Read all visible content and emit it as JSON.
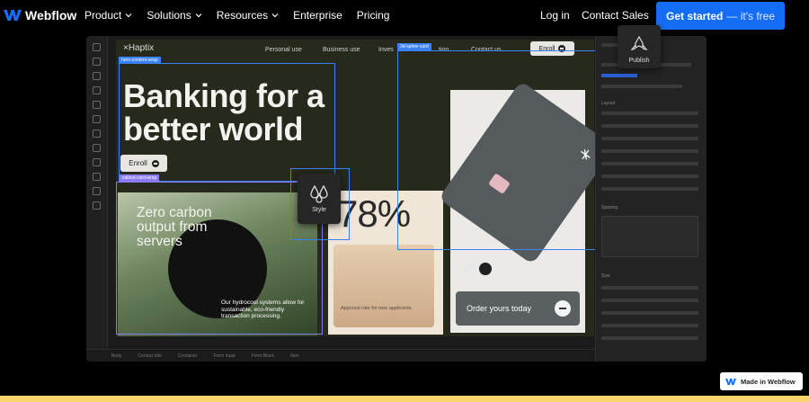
{
  "brand": {
    "name": "Webflow"
  },
  "nav": {
    "items": [
      {
        "label": "Product",
        "dropdown": true
      },
      {
        "label": "Solutions",
        "dropdown": true
      },
      {
        "label": "Resources",
        "dropdown": true
      },
      {
        "label": "Enterprise",
        "dropdown": false
      },
      {
        "label": "Pricing",
        "dropdown": false
      }
    ],
    "login": "Log in",
    "contact": "Contact Sales",
    "cta": {
      "label": "Get started",
      "sub": "— it's free"
    }
  },
  "colors": {
    "accent": "#146ef5",
    "page_bg": "#000000",
    "bottom_strip": "#f7d36b"
  },
  "designer": {
    "site": {
      "logo": "×Haptix",
      "nav": [
        "Personal use",
        "Business use",
        "Inves",
        "tion",
        "Contact us"
      ],
      "enroll_top": "Enroll",
      "hero_title": "Banking for a better world",
      "hero_enroll": "Enroll",
      "green_card": {
        "heading": "Zero carbon output from servers",
        "body": "Our hydrocool systems allow for sustainable, eco-friendly transaction processing."
      },
      "beige_card": {
        "stat": "78%",
        "caption": "Approval rate for new applicants"
      },
      "order_button": "Order yours today"
    },
    "tags": {
      "hero": "hero-content-wrap",
      "callout": "callout-card-wrap",
      "spline": "3d-spline-card"
    },
    "popovers": {
      "style": "Style",
      "publish": "Publish"
    },
    "right_panel": {
      "sections": [
        "Layout",
        "Spacing",
        "Size"
      ]
    },
    "bottom_bar": [
      "Body",
      "Contact title",
      "Container",
      "Form Input",
      "Form Block",
      "Item"
    ]
  },
  "badge": {
    "label": "Made in Webflow"
  }
}
